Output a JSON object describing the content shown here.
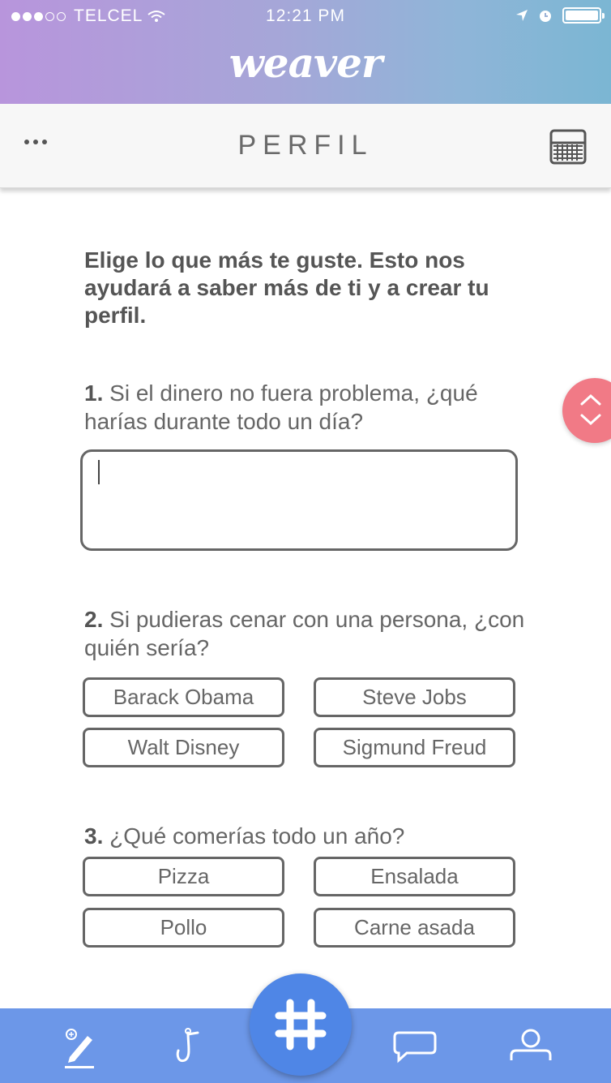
{
  "status_bar": {
    "carrier": "TELCEL",
    "time": "12:21 PM"
  },
  "app": {
    "brand": "weaver"
  },
  "header": {
    "title": "PERFIL"
  },
  "intro": "Elige lo que más te guste. Esto nos ayudará a saber más de ti y a crear tu perfil.",
  "questions": [
    {
      "number": "1.",
      "text": "Si el dinero no fuera problema, ¿qué harías durante todo un día?"
    },
    {
      "number": "2.",
      "text": "Si pudieras cenar con una persona, ¿con quién sería?",
      "options": [
        "Barack Obama",
        "Steve Jobs",
        "Walt Disney",
        "Sigmund Freud"
      ]
    },
    {
      "number": "3.",
      "text": "¿Qué comerías todo un año?",
      "options": [
        "Pizza",
        "Ensalada",
        "Pollo",
        "Carne asada"
      ]
    }
  ],
  "colors": {
    "accent_nav": "#6c97e8",
    "fab": "#4f86e6",
    "scroll_button": "#f17a86"
  },
  "icons": {
    "nav": [
      "pencil-edit-icon",
      "hook-icon",
      "hashtag-icon",
      "chat-bubble-icon",
      "user-icon"
    ],
    "header": [
      "more-icon",
      "basket-icon"
    ]
  }
}
